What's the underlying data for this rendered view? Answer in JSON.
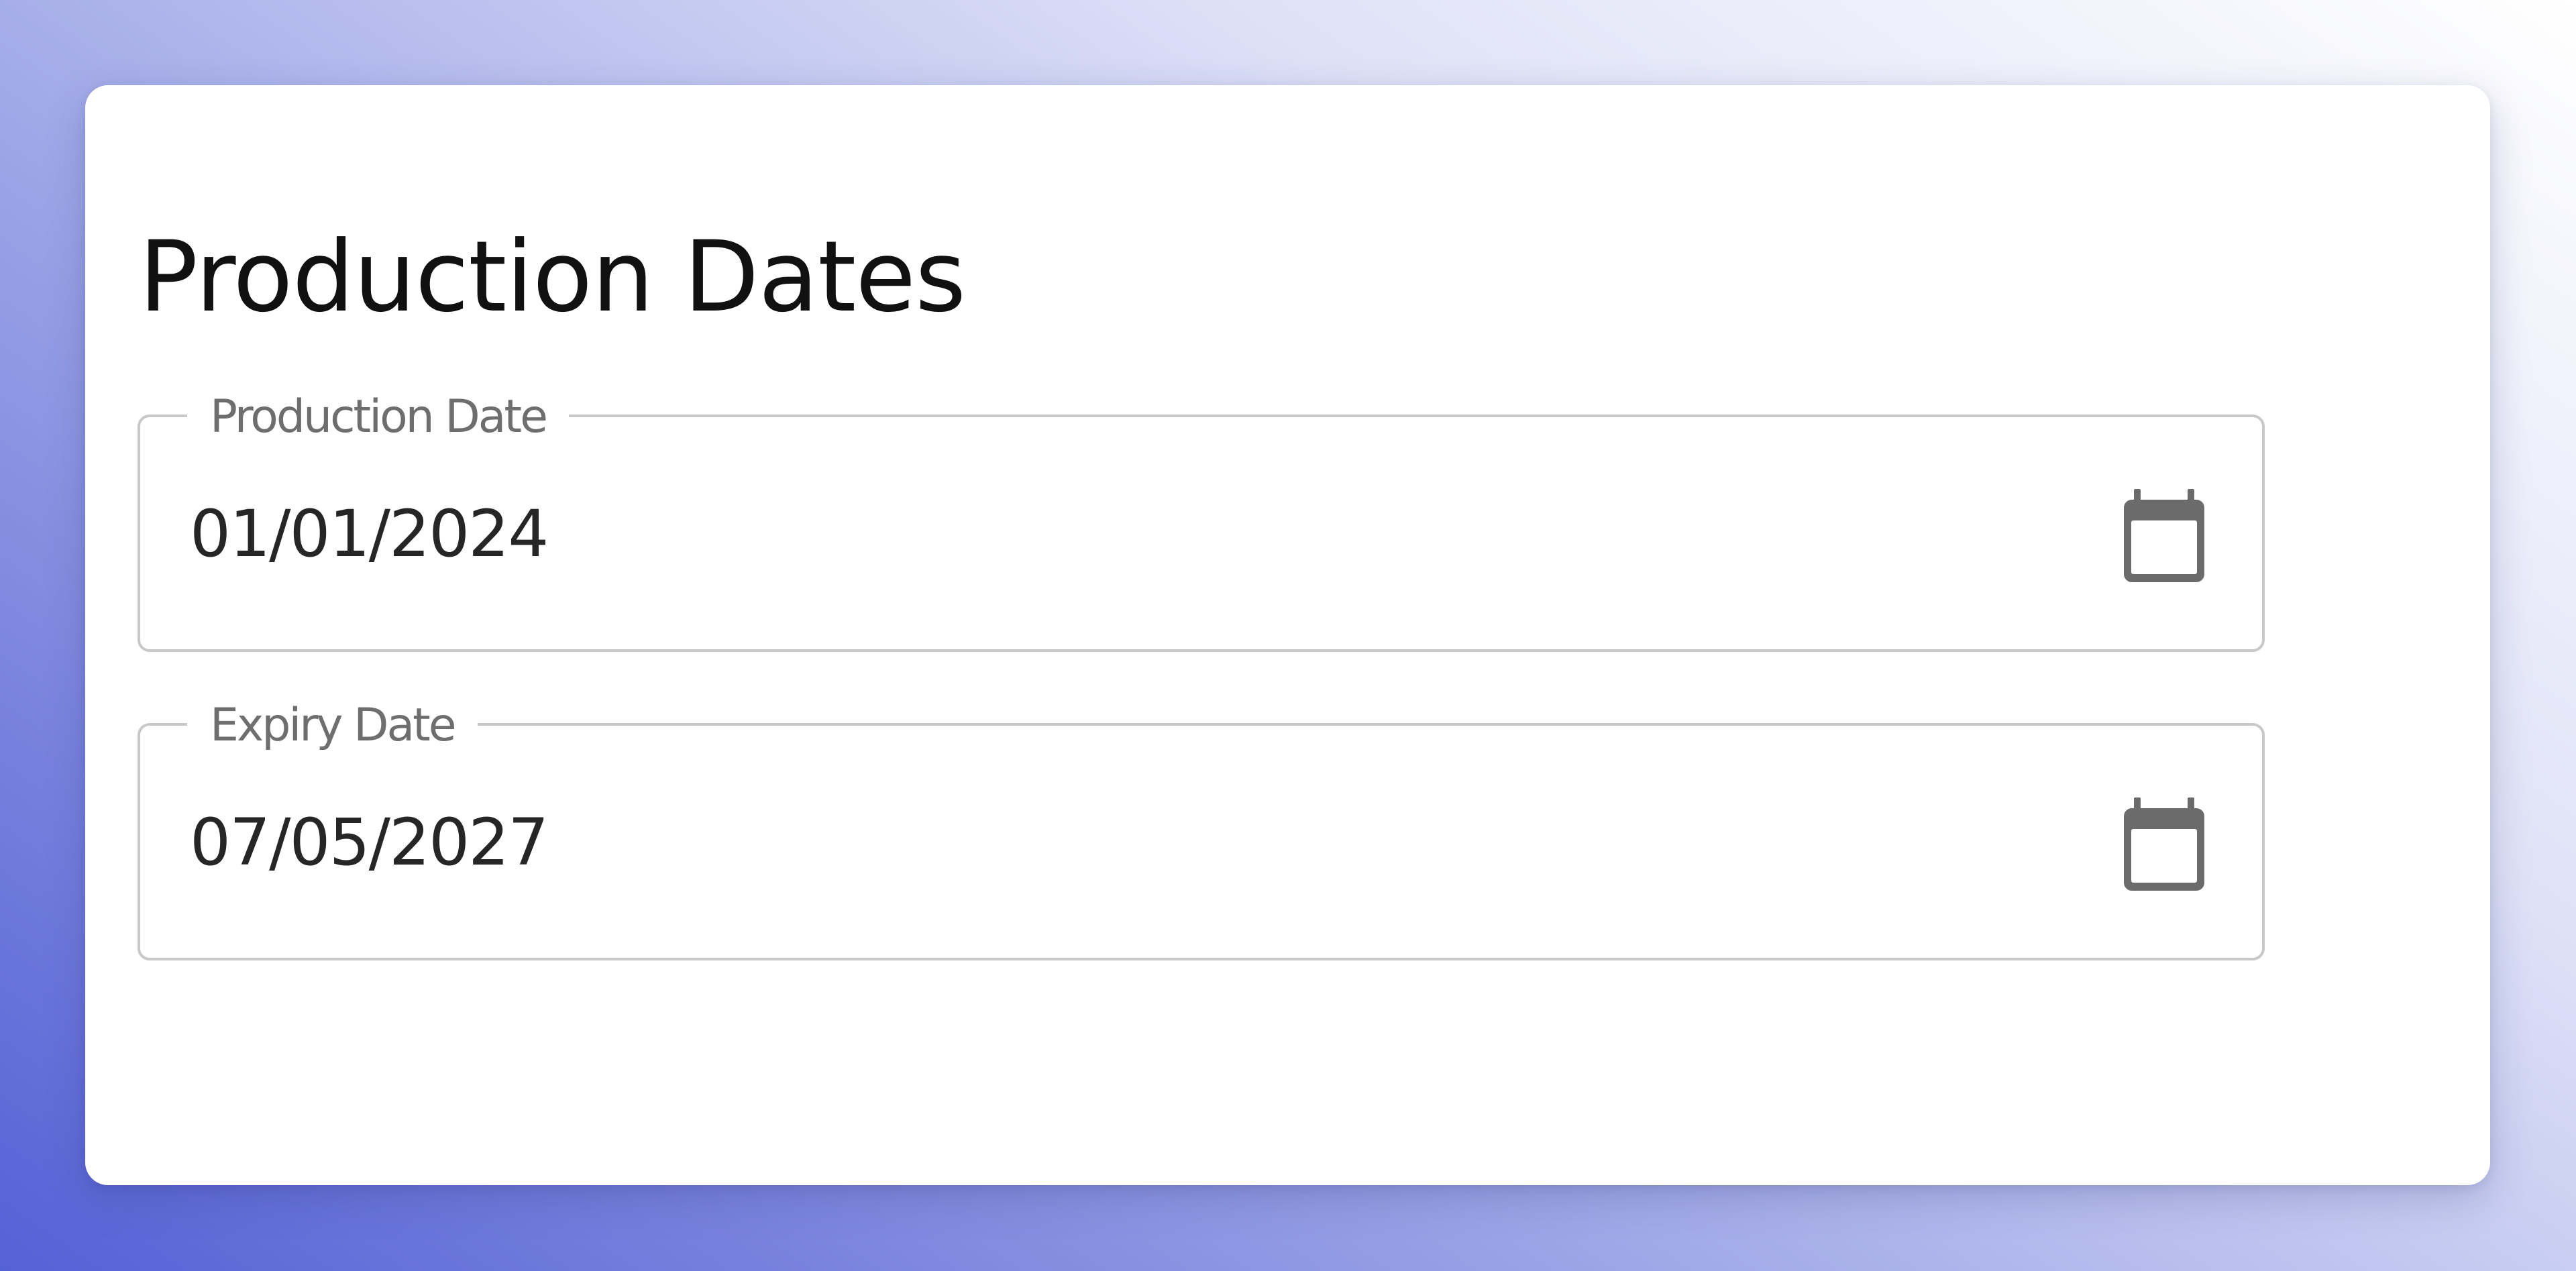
{
  "header": {
    "title": "Production Dates"
  },
  "fields": {
    "production": {
      "label": "Production Date",
      "value": "01/01/2024",
      "icon": "calendar-icon"
    },
    "expiry": {
      "label": "Expiry Date",
      "value": "07/05/2027",
      "icon": "calendar-icon"
    }
  },
  "colors": {
    "border": "#c8c8c8",
    "label": "#6e6e6e",
    "value": "#262626",
    "icon": "#6b6b6b",
    "title": "#111111",
    "background_start": "#5561d6",
    "background_end": "#ffffff"
  }
}
